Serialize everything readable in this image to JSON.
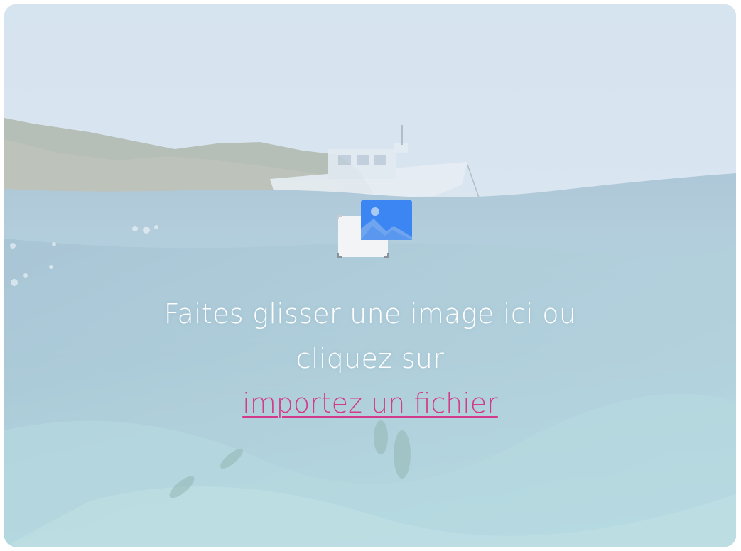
{
  "upload": {
    "prompt_line1": "Faites glisser une image ici ou",
    "prompt_line2": "cliquez sur",
    "link_label": "importez un fichier",
    "link_color": "#d23a8a",
    "text_color": "#ffffff",
    "icon": "image-upload-icon"
  },
  "background": {
    "description_icon": "boat-underwater-photo"
  }
}
